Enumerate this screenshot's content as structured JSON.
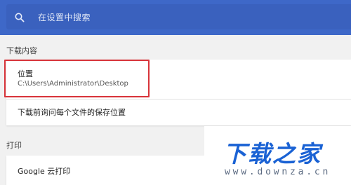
{
  "search": {
    "placeholder": "在设置中搜索",
    "icon": "search-icon"
  },
  "download_section": {
    "title": "下载内容",
    "location": {
      "label": "位置",
      "path": "C:\\Users\\Administrator\\Desktop"
    },
    "ask_each_file_label": "下载前询问每个文件的保存位置"
  },
  "print_section": {
    "title": "打印",
    "cloud_print_label": "Google 云打印"
  },
  "watermark": {
    "logo_text": "下载之家",
    "url": "www.downza.cn"
  },
  "colors": {
    "topbar": "#3e68c8",
    "highlight": "#d8343a",
    "watermark": "#1a62d4"
  }
}
